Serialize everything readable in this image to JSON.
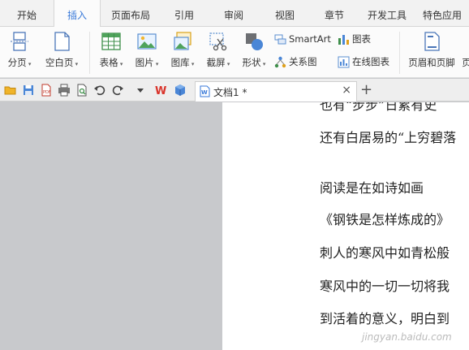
{
  "menu": {
    "tabs": [
      "开始",
      "插入",
      "页面布局",
      "引用",
      "审阅",
      "视图",
      "章节",
      "开发工具",
      "特色应用"
    ],
    "active_index": 1
  },
  "ribbon": {
    "page_break": "分页",
    "blank_page": "空白页",
    "table": "表格",
    "picture": "图片",
    "gallery": "图库",
    "screenshot": "截屏",
    "shapes": "形状",
    "smartart": "SmartArt",
    "chart": "图表",
    "relation_chart": "关系图",
    "online_chart": "在线图表",
    "header_footer": "页眉和页脚",
    "cut_label": "页"
  },
  "quickbar": {
    "icons": [
      "open-folder-icon",
      "save-icon",
      "export-pdf-icon",
      "print-icon",
      "print-preview-icon",
      "undo-icon",
      "redo-icon",
      "dropdown-icon"
    ]
  },
  "doc_tab": {
    "title": "文档1 *",
    "close": "×",
    "add": "+"
  },
  "document": {
    "lines": [
      "也有“步步”日累有史",
      "还有白居易的“上穷碧落",
      "",
      "    阅读是在如诗如画",
      "《钢铁是怎样炼成的》",
      "刺人的寒风中如青松般",
      "寒风中的一切一切将我",
      "到活着的意义，明白到"
    ]
  },
  "watermark": "jingyan.baidu.com",
  "colors": {
    "accent": "#3a7ad9",
    "workspace": "#c8c9cc",
    "page": "#ffffff"
  }
}
